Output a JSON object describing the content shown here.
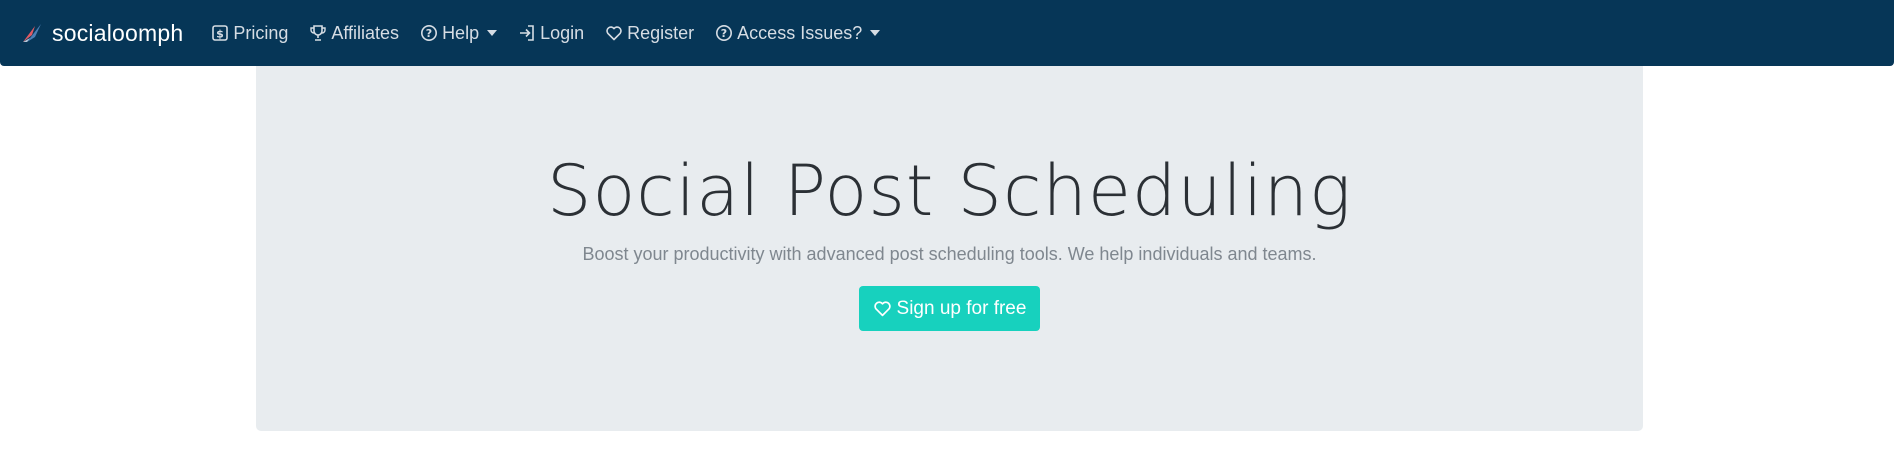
{
  "navbar": {
    "brand_name": "socialoomph",
    "brand_icon": "paper-plane-logo-icon",
    "items": [
      {
        "label": "Pricing",
        "icon": "dollar-square-icon",
        "dropdown": false
      },
      {
        "label": "Affiliates",
        "icon": "trophy-icon",
        "dropdown": false
      },
      {
        "label": "Help",
        "icon": "question-circle-icon",
        "dropdown": true
      },
      {
        "label": "Login",
        "icon": "sign-in-icon",
        "dropdown": false
      },
      {
        "label": "Register",
        "icon": "heart-icon",
        "dropdown": false
      },
      {
        "label": "Access Issues?",
        "icon": "question-circle-icon",
        "dropdown": true
      }
    ]
  },
  "hero": {
    "title": "Social Post Scheduling",
    "subtitle": "Boost your productivity with advanced post scheduling tools. We help individuals and teams.",
    "cta_label": "Sign up for free",
    "cta_icon": "heart-icon"
  },
  "colors": {
    "navbar_bg": "#063657",
    "hero_bg": "#e8ecef",
    "cta_bg": "#17d1be"
  }
}
